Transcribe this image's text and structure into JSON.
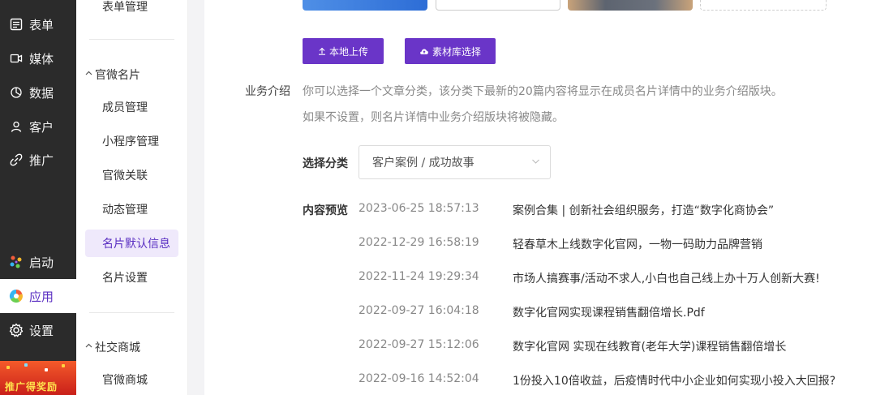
{
  "nav": {
    "items": [
      {
        "label": "表单",
        "icon": "form-icon"
      },
      {
        "label": "媒体",
        "icon": "media-icon"
      },
      {
        "label": "数据",
        "icon": "data-icon"
      },
      {
        "label": "客户",
        "icon": "customer-icon"
      },
      {
        "label": "推广",
        "icon": "promote-icon"
      },
      {
        "label": "启动",
        "icon": "launch-icon"
      },
      {
        "label": "应用",
        "icon": "apps-icon"
      },
      {
        "label": "设置",
        "icon": "settings-icon"
      }
    ],
    "active": "应用",
    "promo_label": "推广得奖励"
  },
  "subnav": {
    "top_item": "表单管理",
    "group1": {
      "label": "官微名片",
      "items": [
        "成员管理",
        "小程序管理",
        "官微关联",
        "动态管理",
        "名片默认信息",
        "名片设置"
      ]
    },
    "active": "名片默认信息",
    "group2": {
      "label": "社交商城",
      "items": [
        "官微商城"
      ]
    }
  },
  "upload": {
    "local_button": "本地上传",
    "library_button": "素材库选择"
  },
  "business": {
    "label": "业务介绍",
    "hint1": "你可以选择一个文章分类，该分类下最新的20篇内容将显示在成员名片详情中的业务介绍版块。",
    "hint2": "如果不设置，则名片详情中业务介绍版块将被隐藏。",
    "category_label": "选择分类",
    "category_value": "客户案例 / 成功故事",
    "preview_label": "内容预览",
    "preview": [
      {
        "date": "2023-06-25 18:57:13",
        "title": "案例合集 | 创新社会组织服务，打造“数字化商协会”"
      },
      {
        "date": "2022-12-29 16:58:19",
        "title": "轻春草木上线数字化官网，一物一码助力品牌营销"
      },
      {
        "date": "2022-11-24 19:29:34",
        "title": "市场人搞赛事/活动不求人,小白也自己线上办十万人创新大赛!"
      },
      {
        "date": "2022-09-27 16:04:18",
        "title": "数字化官网实现课程销售翻倍增长.Pdf"
      },
      {
        "date": "2022-09-27 15:12:06",
        "title": "数字化官网 实现在线教育(老年大学)课程销售翻倍增长"
      },
      {
        "date": "2022-09-16 14:52:04",
        "title": "1份投入10倍收益，后疫情时代中小企业如何实现小投入大回报?"
      }
    ]
  },
  "colors": {
    "accent": "#6a35c8",
    "nav_bg": "#2b2b2b"
  }
}
